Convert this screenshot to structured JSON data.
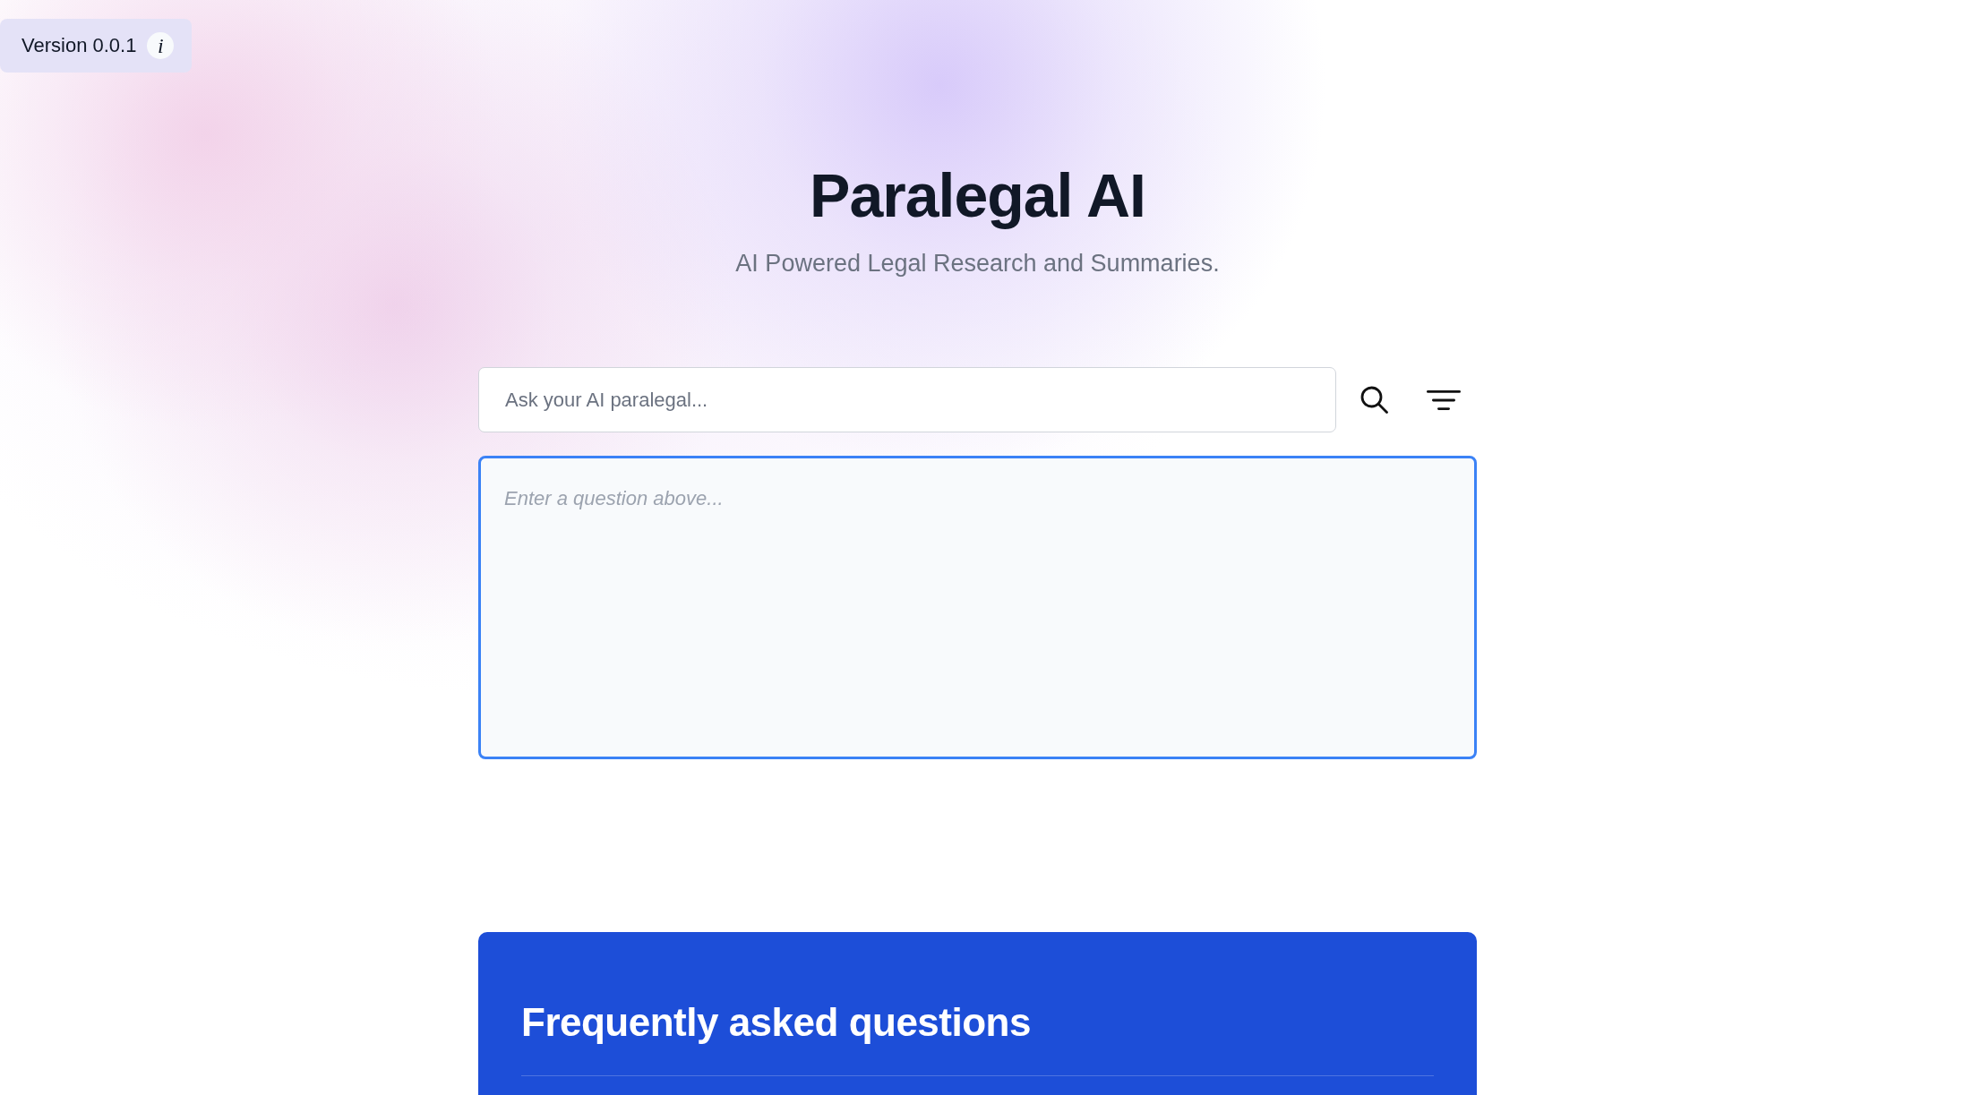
{
  "version_badge": {
    "label": "Version 0.0.1",
    "info_glyph": "i"
  },
  "header": {
    "title": "Paralegal AI",
    "subtitle": "AI Powered Legal Research and Summaries."
  },
  "search": {
    "placeholder": "Ask your AI paralegal..."
  },
  "answer": {
    "empty_message": "Enter a question above..."
  },
  "faq": {
    "title": "Frequently asked questions"
  }
}
